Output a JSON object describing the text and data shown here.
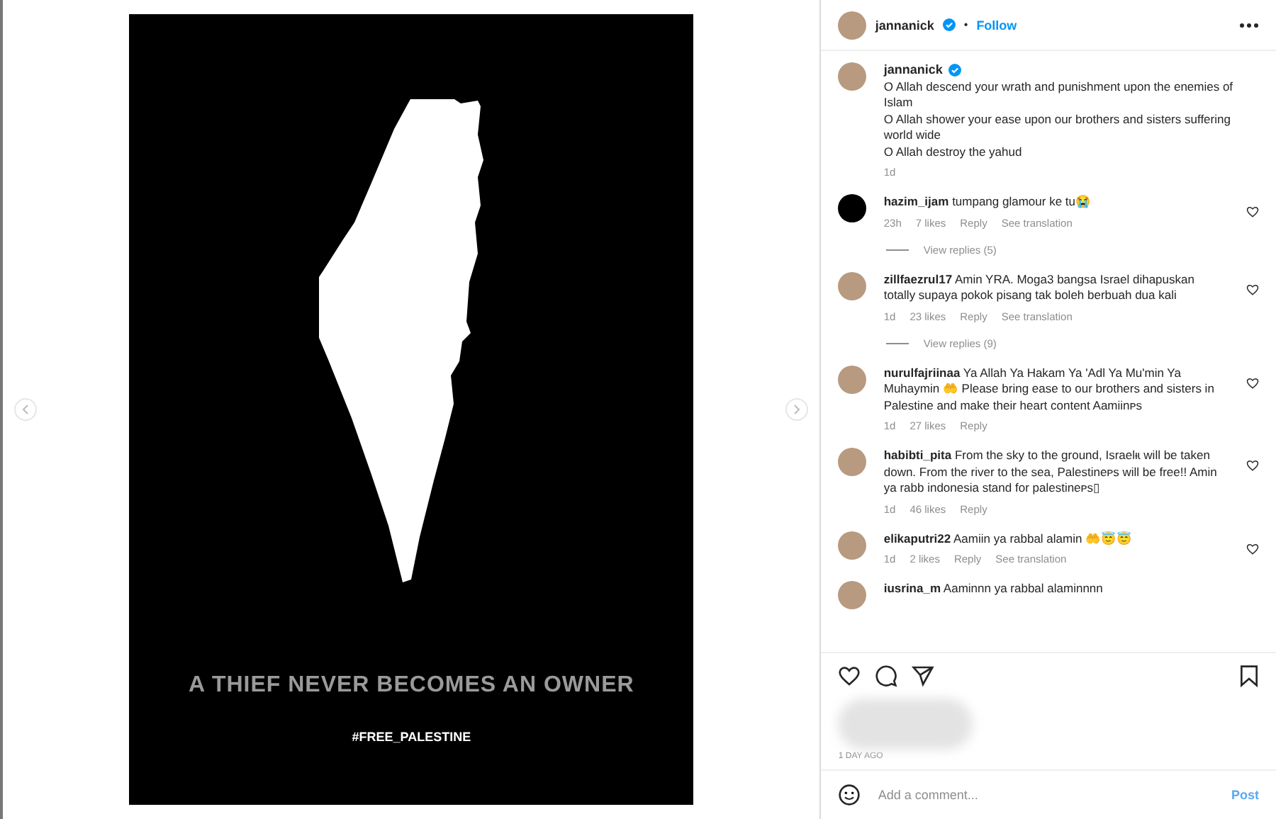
{
  "poster": {
    "headline": "A THIEF NEVER BECOMES AN OWNER",
    "hashtag": "#FREE_PALESTINE"
  },
  "header": {
    "username": "jannanick",
    "separator": "•",
    "follow": "Follow"
  },
  "caption": {
    "username": "jannanick",
    "lines": [
      "O Allah descend your wrath and punishment upon the enemies of Islam",
      "O Allah shower your ease upon our brothers and sisters suffering world wide",
      "O Allah destroy the yahud"
    ],
    "time": "1d"
  },
  "comments": [
    {
      "kind": "blank",
      "username": "hazim_ijam",
      "text": "tumpang glamour ke tu😭",
      "time": "23h",
      "likes": "7 likes",
      "reply": "Reply",
      "translation": "See translation",
      "view_replies": "View replies (5)"
    },
    {
      "kind": "photo",
      "username": "zillfaezrul17",
      "text": "Amin YRA. Moga3 bangsa Israel dihapuskan totally supaya pokok pisang tak boleh berbuah dua kali",
      "time": "1d",
      "likes": "23 likes",
      "reply": "Reply",
      "translation": "See translation",
      "view_replies": "View replies (9)"
    },
    {
      "kind": "photo",
      "username": "nurulfajriinaa",
      "text": "Ya Allah Ya Hakam Ya 'Adl Ya Mu'min Ya Muhaymin 🤲 Please bring ease to our brothers and sisters in Palestine and make their heart content Aamiinᴘs",
      "time": "1d",
      "likes": "27 likes",
      "reply": "Reply"
    },
    {
      "kind": "photo",
      "username": "habibti_pita",
      "text": "From the sky to the ground, Israelᵼɩ will be taken down. From the river to the sea, Palestineᴘs will be free!! Amin ya rabb indonesia stand for palestineᴘs▯",
      "time": "1d",
      "likes": "46 likes",
      "reply": "Reply"
    },
    {
      "kind": "photo",
      "username": "elikaputri22",
      "text": "Aamiin ya rabbal alamin 🤲😇😇",
      "time": "1d",
      "likes": "2 likes",
      "reply": "Reply",
      "translation": "See translation"
    },
    {
      "kind": "photo",
      "username": "iusrina_m",
      "text": "Aaminnn ya rabbal alaminnnn"
    }
  ],
  "post_time": "1 DAY AGO",
  "comment_box": {
    "placeholder": "Add a comment...",
    "post": "Post"
  }
}
